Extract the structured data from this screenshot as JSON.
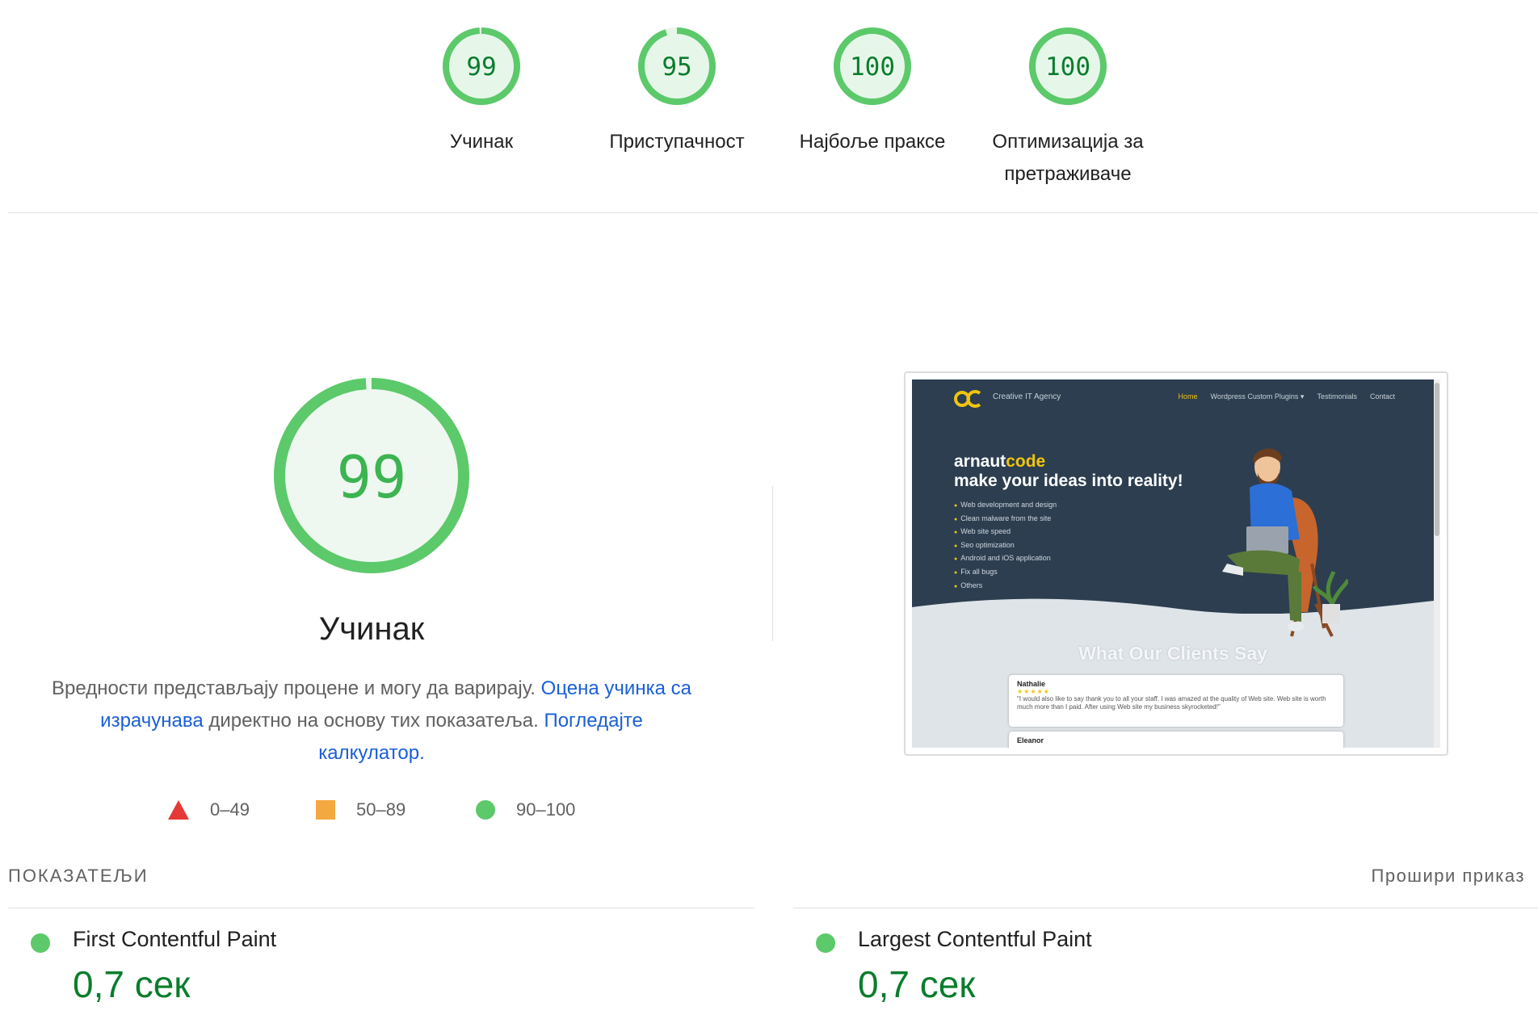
{
  "categories": [
    {
      "score": 99,
      "label": "Учинак"
    },
    {
      "score": 95,
      "label": "Приступачност"
    },
    {
      "score": 100,
      "label": "Најбоље праксе"
    },
    {
      "score": 100,
      "label": "Оптимизација за претраживаче"
    }
  ],
  "performance": {
    "score": 99,
    "title": "Учинак",
    "desc_text1": "Вредности представљају процене и могу да варирају.",
    "desc_link1": "Оцена учинка са израчунава",
    "desc_text2": "директно на основу тих показатеља.",
    "desc_link2": "Погледајте калкулатор."
  },
  "legend": [
    {
      "shape": "triangle",
      "range": "0–49",
      "color": "#e53935"
    },
    {
      "shape": "square",
      "range": "50–89",
      "color": "#f4a940"
    },
    {
      "shape": "circle",
      "range": "90–100",
      "color": "#5cc96a"
    }
  ],
  "preview": {
    "agency": "Creative IT Agency",
    "nav": [
      "Home",
      "Wordpress Custom Plugins ▾",
      "Testimonials",
      "Contact"
    ],
    "brand_a": "arnaut",
    "brand_b": "code",
    "slogan": "make your ideas into reality!",
    "services": [
      "Web development and design",
      "Clean malware from the site",
      "Web site speed",
      "Seo optimization",
      "Android and iOS application",
      "Fix all bugs",
      "Others"
    ],
    "clients_title": "What Our Clients Say",
    "review1_name": "Nathalie",
    "review1_stars": "★★★★★",
    "review1_text": "\"I would also like to say thank you to all your staff. I was amazed at the quality of Web site. Web site is worth much more than I paid. After using Web site my business skyrocketed!\"",
    "review2_name": "Eleanor"
  },
  "metrics": {
    "title": "ПОКАЗАТЕЉИ",
    "expand": "Прошири приказ",
    "items": [
      {
        "name": "First Contentful Paint",
        "value": "0,7 сек"
      },
      {
        "name": "Largest Contentful Paint",
        "value": "0,7 сек"
      }
    ]
  },
  "colors": {
    "pass_green": "#0a7d2c",
    "gauge_green": "#5cc96a",
    "gauge_fill": "#e6f7ea",
    "link_blue": "#1a5fd6"
  }
}
